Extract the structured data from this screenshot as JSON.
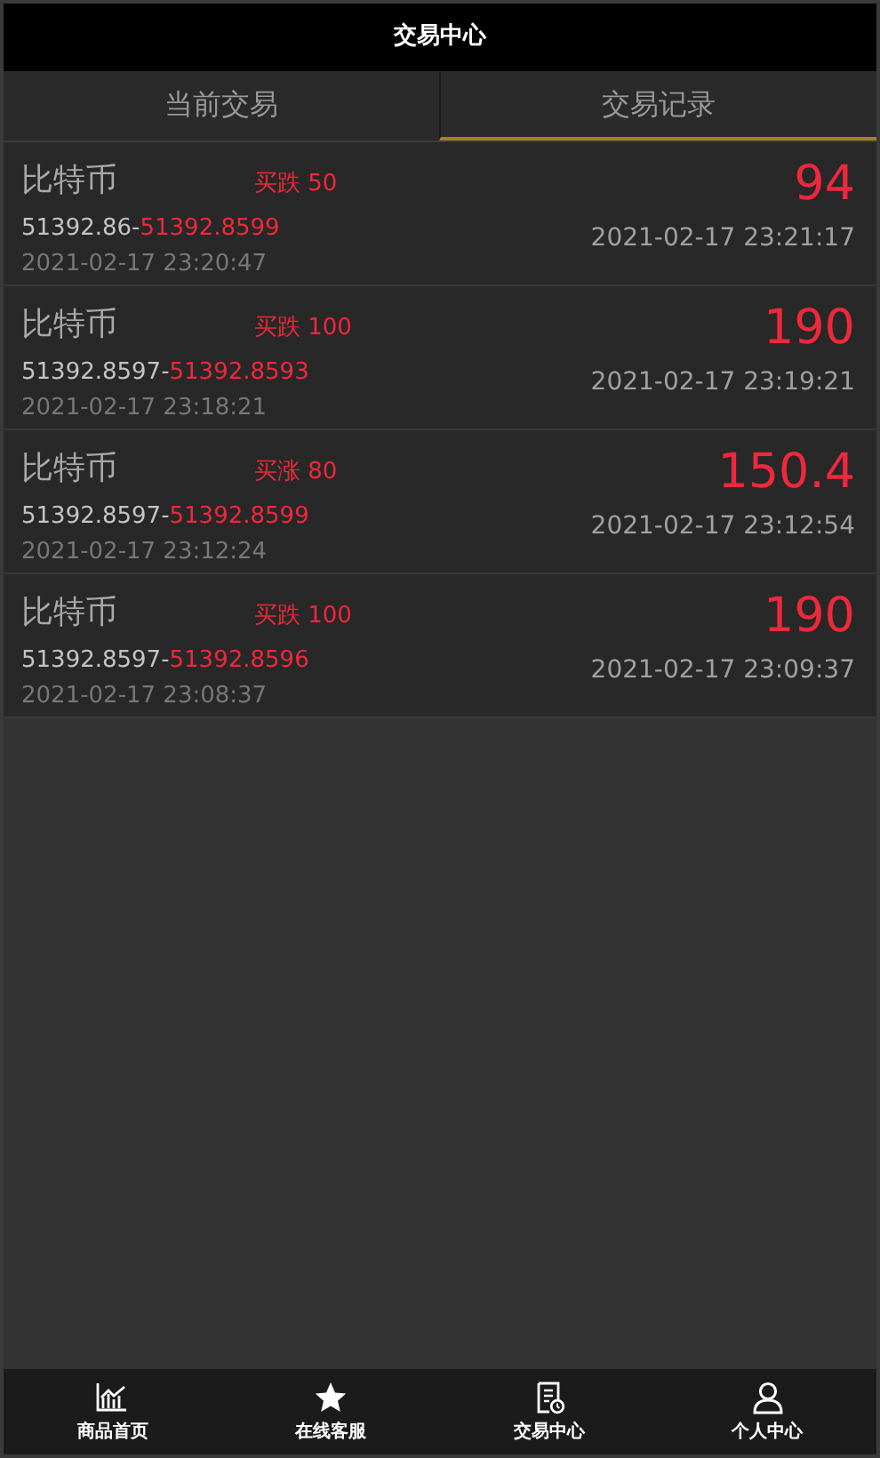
{
  "header": {
    "title": "交易中心"
  },
  "tabs": [
    {
      "label": "当前交易",
      "selected": false
    },
    {
      "label": "交易记录",
      "selected": true
    }
  ],
  "records": [
    {
      "name": "比特币",
      "trade": "买跌 50",
      "open_price": "51392.86-",
      "close_price": "51392.8599",
      "open_time": "2021-02-17 23:20:47",
      "amount": "94",
      "close_time": "2021-02-17 23:21:17"
    },
    {
      "name": "比特币",
      "trade": "买跌 100",
      "open_price": "51392.8597-",
      "close_price": "51392.8593",
      "open_time": "2021-02-17 23:18:21",
      "amount": "190",
      "close_time": "2021-02-17 23:19:21"
    },
    {
      "name": "比特币",
      "trade": "买涨 80",
      "open_price": "51392.8597-",
      "close_price": "51392.8599",
      "open_time": "2021-02-17 23:12:24",
      "amount": "150.4",
      "close_time": "2021-02-17 23:12:54"
    },
    {
      "name": "比特币",
      "trade": "买跌 100",
      "open_price": "51392.8597-",
      "close_price": "51392.8596",
      "open_time": "2021-02-17 23:08:37",
      "amount": "190",
      "close_time": "2021-02-17 23:09:37"
    }
  ],
  "bottom_nav": [
    {
      "kind": "chart",
      "label": "商品首页"
    },
    {
      "kind": "star",
      "label": "在线客服"
    },
    {
      "kind": "document",
      "label": "交易中心"
    },
    {
      "kind": "person",
      "label": "个人中心"
    }
  ]
}
